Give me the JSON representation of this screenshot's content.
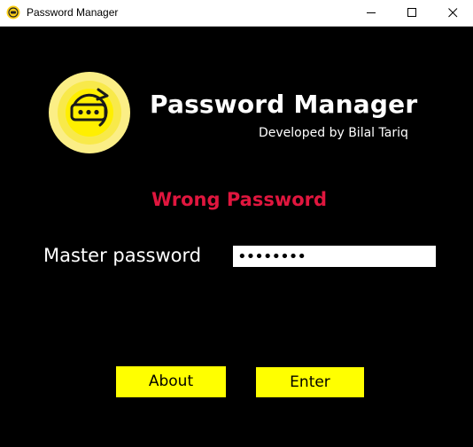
{
  "window": {
    "title": "Password Manager",
    "controls": [
      "minimize-icon",
      "maximize-icon",
      "close-icon"
    ]
  },
  "header": {
    "logo_icon": "password-refresh-icon",
    "app_name": "Password Manager",
    "developer": "Developed by Bilal Tariq"
  },
  "status": {
    "message": "Wrong Password",
    "color": "#e0163e"
  },
  "form": {
    "master_password_label": "Master password",
    "master_password_value": "••••••••"
  },
  "buttons": {
    "about_label": "About",
    "enter_label": "Enter"
  },
  "colors": {
    "background": "#000000",
    "accent": "#ffff00",
    "error": "#e0163e"
  }
}
